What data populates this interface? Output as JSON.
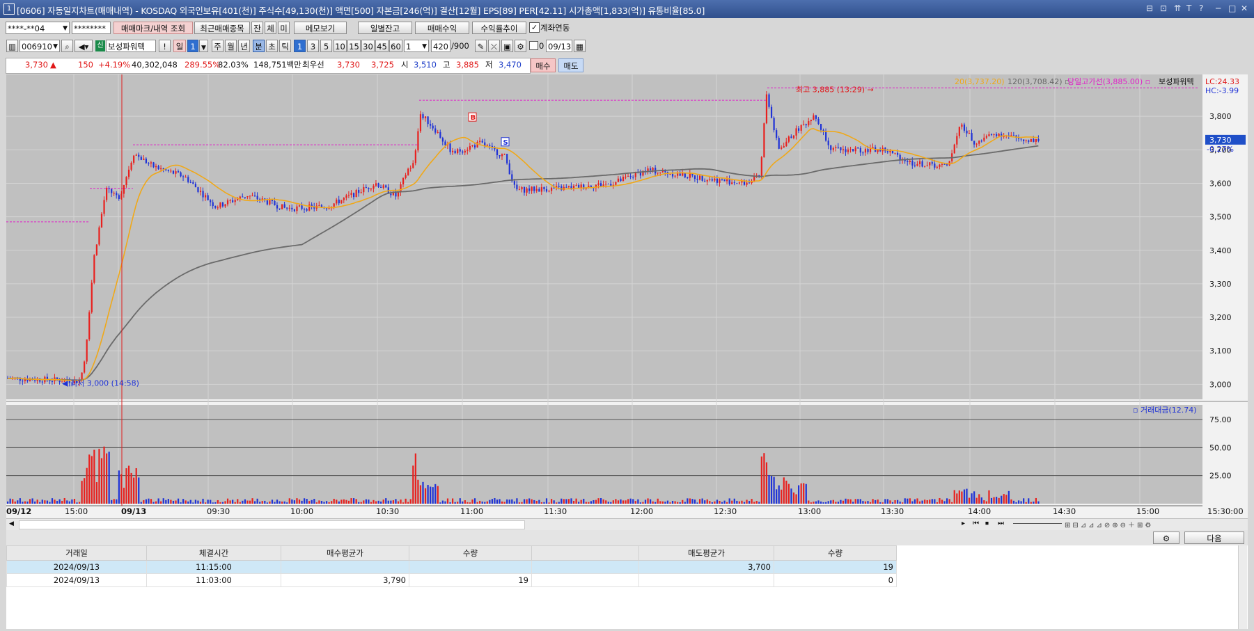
{
  "window": {
    "number": "1",
    "title": "[0606] 자동일지차트(매매내역) - KOSDAQ 외국인보유[401(천)] 주식수[49,130(천)] 액면[500] 자본금[246(억)] 결산[12월] EPS[89] PER[42.11] 시가총액[1,833(억)] 유통비율[85.0]",
    "controls": [
      "⊟",
      "⊡",
      "⇈",
      "T",
      "?",
      "─",
      "□",
      "✕"
    ]
  },
  "toolbar1": {
    "account": "****-**04",
    "password": "********",
    "buttons": [
      "매매마크/내역 조회",
      "최근매매종목",
      "잔",
      "체",
      "미",
      "메모보기",
      "일별잔고",
      "매매수익",
      "수익률추이"
    ],
    "checkbox_label": "계좌연동",
    "checkbox_checked": true
  },
  "toolbar2": {
    "code": "006910",
    "badge": "신",
    "name": "보성파워텍",
    "exclaim": "!",
    "period_buttons": [
      "일",
      "1",
      "주",
      "월",
      "년",
      "분",
      "초",
      "틱"
    ],
    "minute_buttons": [
      "1",
      "3",
      "5",
      "10",
      "15",
      "30",
      "45",
      "60"
    ],
    "interval": "1",
    "count": "420",
    "count_total": "/900",
    "checkbox_val": "0",
    "date": "09/13"
  },
  "quote": {
    "price": "3,730",
    "arrow": "▲",
    "change": "150",
    "change_pct": "+4.19%",
    "volume": "40,302,048",
    "vol_ratio": "289.55%",
    "rate": "82.03%",
    "amount": "148,751백만",
    "priority_label": "최우선",
    "ask": "3,730",
    "bid": "3,725",
    "open_label": "시",
    "open": "3,510",
    "high_label": "고",
    "high": "3,885",
    "low_label": "저",
    "low": "3,470",
    "buy_btn": "매수",
    "sell_btn": "매도"
  },
  "chart_data": {
    "type": "candlestick",
    "legend": {
      "ma20": "20(3,737.20)",
      "ma120": "120(3,708.42)",
      "day_high_line": "당일고가선(3,885.00)",
      "stock": "보성파워텍",
      "lc": "LC:24.33",
      "hc": "HC:-3.99"
    },
    "annotations": {
      "high": "최고 3,885 (13:29)",
      "low": "최저 3,000 (14:58)",
      "buy_mark": "B",
      "sell_mark": "S",
      "current_price": "3,730",
      "current_pct": "-0.27%"
    },
    "price_axis": [
      "3,800",
      "3,700",
      "3,600",
      "3,500",
      "3,400",
      "3,300",
      "3,200",
      "3,100",
      "3,000"
    ],
    "price_range": [
      2955,
      3925
    ],
    "volume_label": "거래대금(12.74)",
    "volume_axis": [
      "75.00",
      "50.00",
      "25.00"
    ],
    "volume_range": [
      0,
      88
    ],
    "time_labels": [
      "09/12",
      "15:00",
      "09/13",
      "09:30",
      "10:00",
      "10:30",
      "11:00",
      "11:30",
      "12:00",
      "12:30",
      "13:00",
      "13:30",
      "14:00",
      "14:30",
      "15:00",
      "15:30:00"
    ],
    "day_high_value": 3885,
    "prev_high_value": 3585,
    "prev_day_level": 3485
  },
  "nav_buttons": [
    "▸",
    "⏮",
    "⏹",
    "⏭"
  ],
  "trades": {
    "headers": [
      "거래일",
      "체결시간",
      "매수평균가",
      "수량",
      "",
      "매도평균가",
      "수량"
    ],
    "rows": [
      [
        "2024/09/13",
        "11:15:00",
        "",
        "",
        "",
        "3,700",
        "19"
      ],
      [
        "2024/09/13",
        "11:03:00",
        "3,790",
        "19",
        "",
        "",
        "0"
      ]
    ],
    "next_btn": "다음"
  }
}
